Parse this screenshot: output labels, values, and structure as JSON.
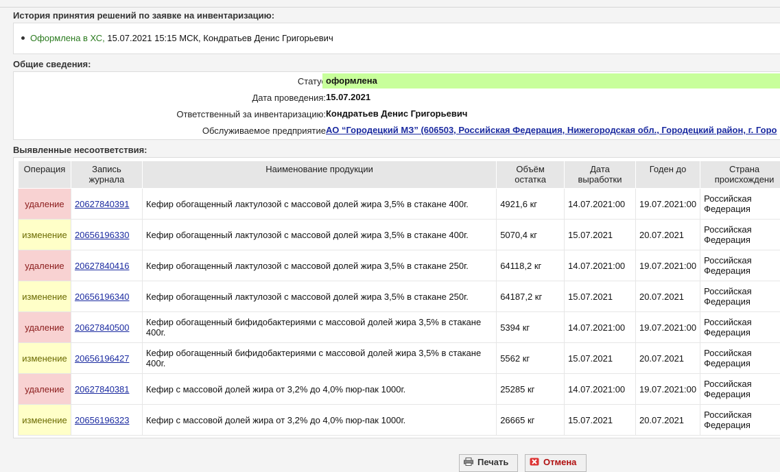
{
  "history": {
    "title": "История принятия решений по заявке на инвентаризацию:",
    "item_status": "Оформлена в ХС,",
    "item_rest": " 15.07.2021 15:15 МСК, Кондратьев Денис Григорьевич"
  },
  "general": {
    "title": "Общие сведения:",
    "status_label": "Статус",
    "status_value": "оформлена",
    "date_label": "Дата проведения:",
    "date_value": "15.07.2021",
    "responsible_label": "Ответственный за инвентаризацию:",
    "responsible_value": "Кондратьев Денис Григорьевич",
    "enterprise_label": "Обслуживаемое предприятие",
    "enterprise_value": "АО “Городецкий МЗ” (606503, Российская Федерация, Нижегородская обл., Городецкий район, г. Горо"
  },
  "mismatches": {
    "title": "Выявленные несоответствия:",
    "headers": [
      "Операция",
      "Запись журнала",
      "Наименование продукции",
      "Объём остатка",
      "Дата выработки",
      "Годен до",
      "Страна происхождени"
    ],
    "rows": [
      {
        "op": "удаление",
        "type": "del",
        "record": "20627840391",
        "name": "Кефир обогащенный лактулозой с массовой долей жира 3,5% в стакане 400г.",
        "volume": "4921,6 кг",
        "made": "14.07.2021:00",
        "expires": "19.07.2021:00",
        "country": "Российская Федерация"
      },
      {
        "op": "изменение",
        "type": "chg",
        "record": "20656196330",
        "name": "Кефир обогащенный лактулозой с массовой долей жира 3,5% в стакане 400г.",
        "volume": "5070,4 кг",
        "made": "15.07.2021",
        "expires": "20.07.2021",
        "country": "Российская Федерация"
      },
      {
        "op": "удаление",
        "type": "del",
        "record": "20627840416",
        "name": "Кефир обогащенный лактулозой с массовой долей жира 3,5% в стакане 250г.",
        "volume": "64118,2 кг",
        "made": "14.07.2021:00",
        "expires": "19.07.2021:00",
        "country": "Российская Федерация"
      },
      {
        "op": "изменение",
        "type": "chg",
        "record": "20656196340",
        "name": "Кефир обогащенный лактулозой с массовой долей жира 3,5% в стакане 250г.",
        "volume": "64187,2 кг",
        "made": "15.07.2021",
        "expires": "20.07.2021",
        "country": "Российская Федерация"
      },
      {
        "op": "удаление",
        "type": "del",
        "record": "20627840500",
        "name": "Кефир обогащенный бифидобактериями с массовой долей жира 3,5% в стакане 400г.",
        "volume": "5394 кг",
        "made": "14.07.2021:00",
        "expires": "19.07.2021:00",
        "country": "Российская Федерация"
      },
      {
        "op": "изменение",
        "type": "chg",
        "record": "20656196427",
        "name": "Кефир обогащенный бифидобактериями с массовой долей жира 3,5% в стакане 400г.",
        "volume": "5562 кг",
        "made": "15.07.2021",
        "expires": "20.07.2021",
        "country": "Российская Федерация"
      },
      {
        "op": "удаление",
        "type": "del",
        "record": "20627840381",
        "name": "Кефир с массовой долей жира от 3,2% до 4,0% пюр-пак 1000г.",
        "volume": "25285 кг",
        "made": "14.07.2021:00",
        "expires": "19.07.2021:00",
        "country": "Российская Федерация"
      },
      {
        "op": "изменение",
        "type": "chg",
        "record": "20656196323",
        "name": "Кефир с массовой долей жира от 3,2% до 4,0% пюр-пак 1000г.",
        "volume": "26665 кг",
        "made": "15.07.2021",
        "expires": "20.07.2021",
        "country": "Российская Федерация"
      }
    ]
  },
  "buttons": {
    "print_label": "Печать",
    "cancel_label": "Отмена"
  }
}
